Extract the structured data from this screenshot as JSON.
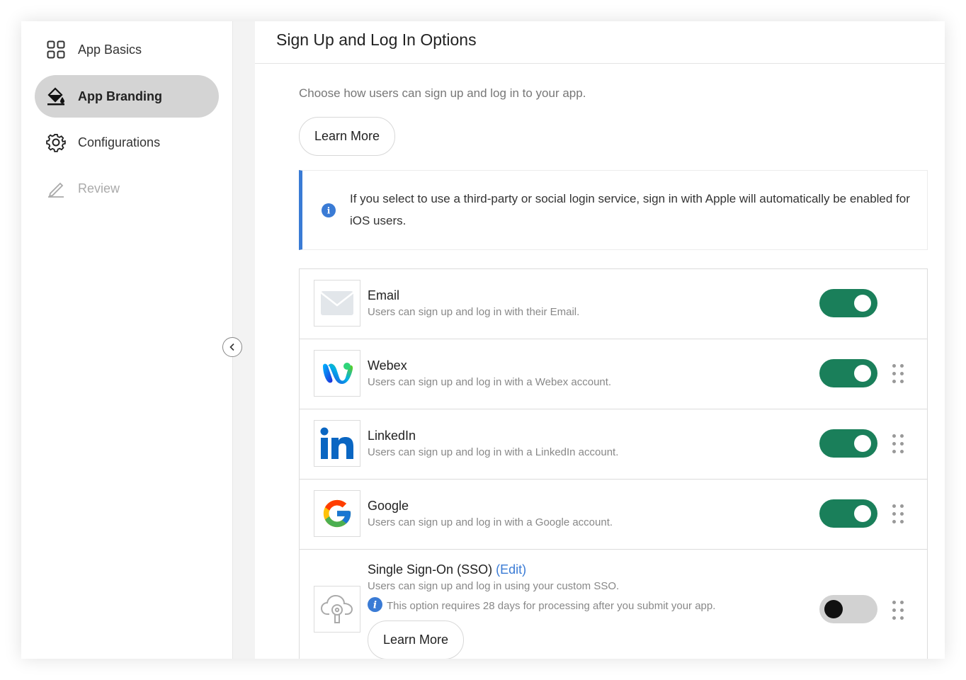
{
  "sidebar": {
    "items": [
      {
        "label": "App Basics",
        "icon": "grid-icon",
        "state": "normal"
      },
      {
        "label": "App Branding",
        "icon": "paint-bucket-icon",
        "state": "active"
      },
      {
        "label": "Configurations",
        "icon": "gear-icon",
        "state": "normal"
      },
      {
        "label": "Review",
        "icon": "pencil-icon",
        "state": "disabled"
      }
    ],
    "collapse_icon": "chevron-left-icon"
  },
  "main": {
    "title": "Sign Up and Log In Options",
    "intro": "Choose how users can sign up and log in to your app.",
    "learn_more_label": "Learn More",
    "info_banner": "If you select to use a third-party or social login service, sign in with Apple will automatically be enabled for iOS users.",
    "options": [
      {
        "name": "Email",
        "desc": "Users can sign up and log in with their Email.",
        "enabled": true,
        "draggable": false,
        "icon": "envelope-icon"
      },
      {
        "name": "Webex",
        "desc": "Users can sign up and log in with a Webex account.",
        "enabled": true,
        "draggable": true,
        "icon": "webex-logo"
      },
      {
        "name": "LinkedIn",
        "desc": "Users can sign up and log in with a LinkedIn account.",
        "enabled": true,
        "draggable": true,
        "icon": "linkedin-logo"
      },
      {
        "name": "Google",
        "desc": "Users can sign up and log in with a Google account.",
        "enabled": true,
        "draggable": true,
        "icon": "google-logo"
      },
      {
        "name": "Single Sign-On (SSO)",
        "edit_label": "(Edit)",
        "desc": "Users can sign up and log in using your custom SSO.",
        "note": "This option requires 28 days for processing after you submit your app.",
        "learn_more_label": "Learn More",
        "enabled": false,
        "draggable": true,
        "icon": "cloud-keyhole-icon"
      }
    ]
  },
  "colors": {
    "toggle_on": "#1a7f5a",
    "toggle_off": "#d2d2d2",
    "accent_blue": "#3a7bd5",
    "active_nav": "#d4d4d4"
  }
}
